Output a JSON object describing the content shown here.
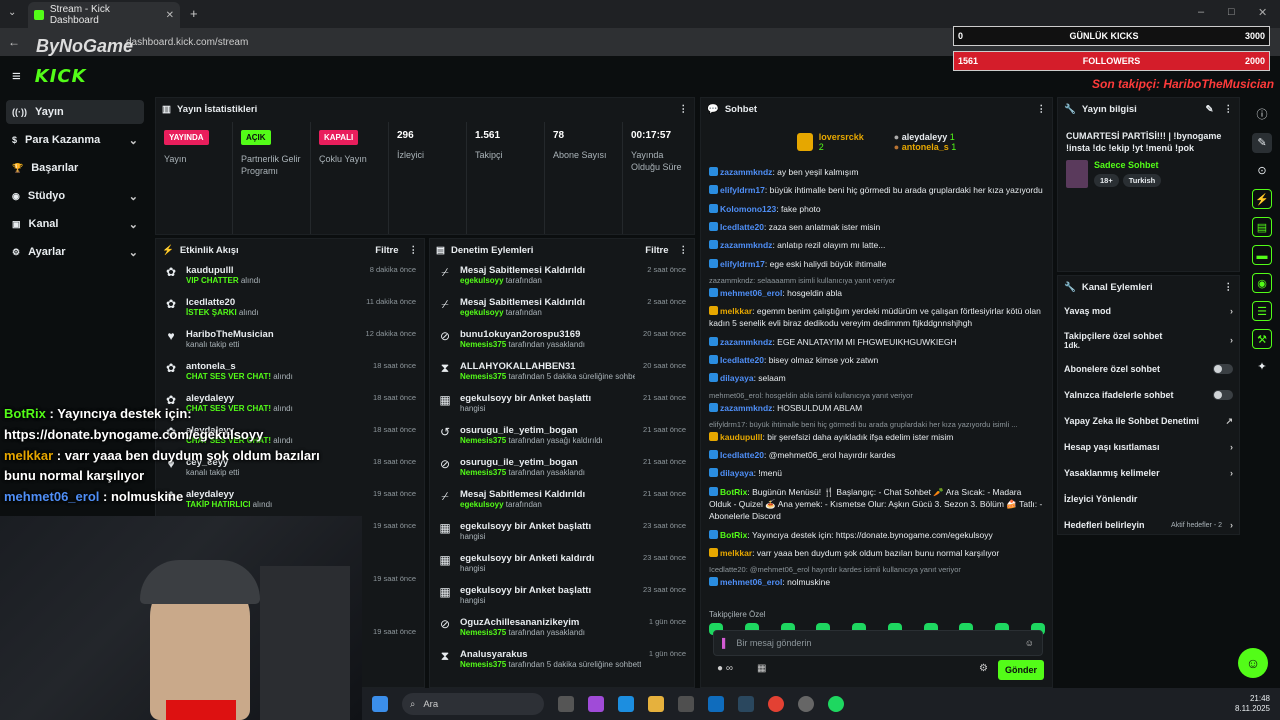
{
  "browser": {
    "tab_title": "Stream - Kick Dashboard",
    "url": "dashboard.kick.com/stream"
  },
  "overlay": {
    "kicks_label": "GÜNLÜK KICKS",
    "kicks_current": "0",
    "kicks_goal": "3000",
    "followers_label": "FOLLOWERS",
    "followers_current": "1561",
    "followers_goal": "2000",
    "last_follower": "Son takipçi: HariboTheMusician",
    "bynogame": "ByNoGame",
    "chat": [
      {
        "user": "BotRix",
        "text": " : Yayıncıya destek için: https://donate.bynogame.com/egekulsoyy",
        "cls": "bot"
      },
      {
        "user": "melkkar",
        "text": " : varr yaaa ben duydum şok oldum bazıları bunu normal karşılıyor",
        "cls": "mel"
      },
      {
        "user": "mehmet06_erol",
        "text": " : nolmuskine",
        "cls": "meh"
      }
    ]
  },
  "header": {
    "logo": "KICK"
  },
  "sidebar": {
    "items": [
      {
        "label": "Yayın",
        "icon": "stream-icon",
        "active": true,
        "chev": false
      },
      {
        "label": "Para Kazanma",
        "icon": "money-icon",
        "active": false,
        "chev": true
      },
      {
        "label": "Başarılar",
        "icon": "trophy-icon",
        "active": false,
        "chev": false
      },
      {
        "label": "Stüdyo",
        "icon": "studio-icon",
        "active": false,
        "chev": true
      },
      {
        "label": "Kanal",
        "icon": "channel-icon",
        "active": false,
        "chev": true
      },
      {
        "label": "Ayarlar",
        "icon": "settings-icon",
        "active": false,
        "chev": true
      }
    ]
  },
  "stats": {
    "title": "Yayın İstatistikleri",
    "cells": [
      {
        "badge": "YAYINDA",
        "kind": "red",
        "label": "Yayın"
      },
      {
        "badge": "AÇIK",
        "kind": "green",
        "label": "Partnerlik Gelir Programı"
      },
      {
        "badge": "KAPALI",
        "kind": "red",
        "label": "Çoklu Yayın"
      },
      {
        "num": "296",
        "label": "İzleyici"
      },
      {
        "num": "1.561",
        "label": "Takipçi"
      },
      {
        "num": "78",
        "label": "Abone Sayısı"
      },
      {
        "num": "00:17:57",
        "label": "Yayında Olduğu Süre"
      }
    ]
  },
  "activity": {
    "title": "Etkinlik Akışı",
    "filter": "Filtre",
    "rows": [
      {
        "user": "kaudupulll",
        "tag": "VIP CHATTER",
        "action": " alındı",
        "time": "8 dakika önce",
        "icon": "gift-icon"
      },
      {
        "user": "Icedlatte20",
        "tag": "İSTEK ŞARKI",
        "action": " alındı",
        "time": "11 dakika önce",
        "icon": "gift-icon"
      },
      {
        "user": "HariboTheMusician",
        "tag": "",
        "action": "kanalı takip etti",
        "time": "12 dakika önce",
        "icon": "heart-icon"
      },
      {
        "user": "antonela_s",
        "tag": "CHAT SES VER CHAT!",
        "action": " alındı",
        "time": "18 saat önce",
        "icon": "gift-icon"
      },
      {
        "user": "aleydaleyy",
        "tag": "CHAT SES VER CHAT!",
        "action": " alındı",
        "time": "18 saat önce",
        "icon": "gift-icon"
      },
      {
        "user": "aleydaleyy",
        "tag": "CHAT SES VER CHAT!",
        "action": " alındı",
        "time": "18 saat önce",
        "icon": "gift-icon"
      },
      {
        "user": "cey_ceyy",
        "tag": "",
        "action": "kanalı takip etti",
        "time": "18 saat önce",
        "icon": "heart-icon"
      },
      {
        "user": "aleydaleyy",
        "tag": "TAKİP HATIRLICI",
        "action": " alındı",
        "time": "19 saat önce",
        "icon": "gift-icon"
      }
    ],
    "extra_times": [
      "19 saat önce",
      "19 saat önce",
      "19 saat önce"
    ]
  },
  "moderation": {
    "title": "Denetim Eylemleri",
    "filter": "Filtre",
    "rows": [
      {
        "title": "Mesaj Sabitlemesi Kaldırıldı",
        "by": "egekulsoyy",
        "rest": " tarafından",
        "time": "2 saat önce",
        "icon": "unpin-icon"
      },
      {
        "title": "Mesaj Sabitlemesi Kaldırıldı",
        "by": "egekulsoyy",
        "rest": " tarafından",
        "time": "2 saat önce",
        "icon": "unpin-icon"
      },
      {
        "title": "bunu1okuyan2orospu3169",
        "by": "Nemesis375",
        "rest": " tarafından yasaklandı",
        "time": "20 saat önce",
        "icon": "ban-icon"
      },
      {
        "title": "ALLAHYOKALLAHBEN31",
        "by": "Nemesis375",
        "rest": " tarafından 5 dakika süreliğine sohbetten uzaklaştırıldı",
        "time": "20 saat önce",
        "icon": "timeout-icon"
      },
      {
        "title": "egekulsoyy bir Anket başlattı",
        "by": "",
        "rest": "hangisi",
        "time": "21 saat önce",
        "icon": "poll-icon"
      },
      {
        "title": "osurugu_ile_yetim_bogan",
        "by": "Nemesis375",
        "rest": " tarafından yasağı kaldırıldı",
        "time": "21 saat önce",
        "icon": "unban-icon"
      },
      {
        "title": "osurugu_ile_yetim_bogan",
        "by": "Nemesis375",
        "rest": " tarafından yasaklandı",
        "time": "21 saat önce",
        "icon": "ban-icon"
      },
      {
        "title": "Mesaj Sabitlemesi Kaldırıldı",
        "by": "egekulsoyy",
        "rest": " tarafından",
        "time": "21 saat önce",
        "icon": "unpin-icon"
      },
      {
        "title": "egekulsoyy bir Anket başlattı",
        "by": "",
        "rest": "hangisi",
        "time": "23 saat önce",
        "icon": "poll-icon"
      },
      {
        "title": "egekulsoyy bir Anketi kaldırdı",
        "by": "",
        "rest": "hangisi",
        "time": "23 saat önce",
        "icon": "poll-icon"
      },
      {
        "title": "egekulsoyy bir Anket başlattı",
        "by": "",
        "rest": "hangisi",
        "time": "23 saat önce",
        "icon": "poll-icon"
      },
      {
        "title": "OguzAchillesananizikeyim",
        "by": "Nemesis375",
        "rest": " tarafından yasaklandı",
        "time": "1 gün önce",
        "icon": "ban-icon"
      },
      {
        "title": "Analusyarakus",
        "by": "Nemesis375",
        "rest": " tarafından 5 dakika süreliğine sohbetten uzaklaştırıldı",
        "time": "1 gün önce",
        "icon": "timeout-icon"
      }
    ]
  },
  "chat": {
    "title": "Sohbet",
    "pinned": [
      {
        "name": "loversrckk",
        "count": "2"
      },
      {
        "name": "aleydaleyy",
        "count": "1"
      },
      {
        "name": "antonela_s",
        "count": "1"
      }
    ],
    "messages": [
      {
        "user": "zazammkndz",
        "color": "#4f8ff7",
        "text": "ay ben yeşil kalmışım"
      },
      {
        "user": "elifyldrm17",
        "color": "#4f8ff7",
        "text": "büyük ihtimalle beni hiç görmedi bu arada gruplardaki her kıza yazıyordu"
      },
      {
        "user": "Kolomono123",
        "color": "#4f8ff7",
        "text": "fake photo"
      },
      {
        "user": "Icedlatte20",
        "color": "#4f8ff7",
        "text": "zaza sen anlatmak ister misin"
      },
      {
        "user": "zazammkndz",
        "color": "#4f8ff7",
        "text": "anlatıp rezil olayım mı latte..."
      },
      {
        "user": "elifyldrm17",
        "color": "#4f8ff7",
        "text": "ege eski haliydi büyük ihtimalle"
      },
      {
        "sys": "zazammkndz: selaaaamm isimli kullanıcıya yanıt veriyor"
      },
      {
        "user": "mehmet06_erol",
        "color": "#4f8ff7",
        "text": "hosgeldin abla"
      },
      {
        "user": "melkkar",
        "color": "#e6a700",
        "text": "egemm benim çalıştığım yerdeki müdürüm ve çalışan förtlesiyirlar kötü olan kadın 5 senelik evli biraz dedikodu vereyim dedimmm ftjkddgnnshjhgh"
      },
      {
        "user": "zazammkndz",
        "color": "#4f8ff7",
        "text": "EGE ANLATAYIM MI FHGWEUIKHGUWKIEGH"
      },
      {
        "user": "Icedlatte20",
        "color": "#4f8ff7",
        "text": "bisey olmaz kimse yok zatwn"
      },
      {
        "user": "dilayaya",
        "color": "#4f8ff7",
        "text": "selaam"
      },
      {
        "sys": "mehmet06_erol: hosgeldin abla isimli kullanıcıya yanıt veriyor"
      },
      {
        "user": "zazammkndz",
        "color": "#4f8ff7",
        "text": "HOSBULDUM ABLAM"
      },
      {
        "sys": "elifyldrm17: büyük ihtimalle beni hiç görmedi bu arada gruplardaki her kıza yazıyordu isimli ..."
      },
      {
        "user": "kaudupulll",
        "color": "#e6a700",
        "text": "bir şerefsizi daha ayıkladık ifşa edelim ister misim"
      },
      {
        "user": "Icedlatte20",
        "color": "#4f8ff7",
        "text": "@mehmet06_erol hayırdır kardes"
      },
      {
        "user": "dilayaya",
        "color": "#4f8ff7",
        "text": "!menü"
      },
      {
        "user": "BotRix",
        "color": "#53fc18",
        "text": "Bugünün Menüsü! 🍴 Başlangıç: - Chat Sohbet 🥕 Ara Sıcak: - Madara Olduk - Quizel 🍝 Ana yemek: - Kısmetse Olur: Aşkın Gücü 3. Sezon 3. Bölüm 🍰 Tatlı: - Abonelerle Discord"
      },
      {
        "user": "BotRix",
        "color": "#53fc18",
        "text": "Yayıncıya destek için: https://donate.bynogame.com/egekulsoyy"
      },
      {
        "user": "melkkar",
        "color": "#e6a700",
        "text": "varr yaaa ben duydum şok oldum bazıları bunu normal karşılıyor"
      },
      {
        "sys": "Icedlatte20: @mehmet06_erol hayırdır kardes isimli kullanıcıya yanıt veriyor"
      },
      {
        "user": "mehmet06_erol",
        "color": "#4f8ff7",
        "text": "nolmuskine"
      }
    ],
    "emote_label": "Takipçilere Özel",
    "input_placeholder": "Bir mesaj gönderin",
    "send_label": "Gönder"
  },
  "streaminfo": {
    "title": "Yayın bilgisi",
    "stream_title": "CUMARTESİ PARTİSİ!!! | !bynogame !insta !dc !ekip !yt !menü !pok",
    "category": "Sadece Sohbet",
    "tags": [
      "18+",
      "Turkish"
    ]
  },
  "channelactions": {
    "title": "Kanal Eylemleri",
    "items": [
      {
        "label": "Yavaş mod",
        "sub": "",
        "type": "chevron"
      },
      {
        "label": "Takipçilere özel sohbet",
        "sub": "1dk.",
        "type": "chevron"
      },
      {
        "label": "Abonelere özel sohbet",
        "sub": "",
        "type": "toggle"
      },
      {
        "label": "Yalnızca ifadelerle sohbet",
        "sub": "",
        "type": "toggle"
      },
      {
        "label": "Yapay Zeka ile Sohbet Denetimi",
        "sub": "",
        "type": "external"
      },
      {
        "label": "Hesap yaşı kısıtlaması",
        "sub": "",
        "type": "chevron"
      },
      {
        "label": "Yasaklanmış kelimeler",
        "sub": "",
        "type": "chevron"
      },
      {
        "label": "İzleyici Yönlendir",
        "sub": "",
        "type": "none"
      },
      {
        "label": "Hedefleri belirleyin",
        "sub": "Aktif hedefler - 2",
        "type": "chevron"
      }
    ]
  },
  "taskbar": {
    "search": "Ara",
    "time": "21:48",
    "date": "8.11.2025"
  },
  "colors": {
    "accent": "#53fc18",
    "live": "#e91e5c",
    "bg": "#0b0e0f",
    "panel": "#141719"
  }
}
